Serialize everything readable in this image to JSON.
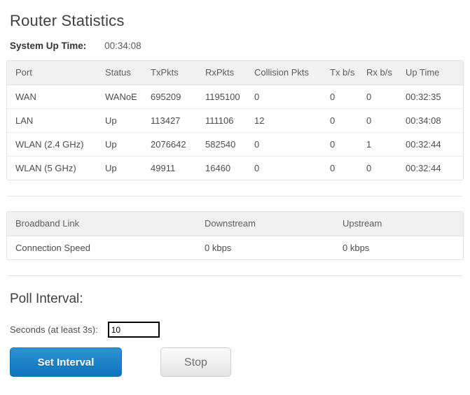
{
  "page": {
    "title": "Router Statistics"
  },
  "uptime": {
    "label": "System Up Time:",
    "value": "00:34:08"
  },
  "stats_table": {
    "headers": [
      "Port",
      "Status",
      "TxPkts",
      "RxPkts",
      "Collision Pkts",
      "Tx b/s",
      "Rx b/s",
      "Up Time"
    ],
    "rows": [
      {
        "port": "WAN",
        "status": "WANoE",
        "txpkts": "695209",
        "rxpkts": "1195100",
        "collision": "0",
        "txbs": "0",
        "rxbs": "0",
        "uptime": "00:32:35"
      },
      {
        "port": "LAN",
        "status": "Up",
        "txpkts": "113427",
        "rxpkts": "111106",
        "collision": "12",
        "txbs": "0",
        "rxbs": "0",
        "uptime": "00:34:08"
      },
      {
        "port": "WLAN (2.4 GHz)",
        "status": "Up",
        "txpkts": "2076642",
        "rxpkts": "582540",
        "collision": "0",
        "txbs": "0",
        "rxbs": "1",
        "uptime": "00:32:44"
      },
      {
        "port": "WLAN (5 GHz)",
        "status": "Up",
        "txpkts": "49911",
        "rxpkts": "16460",
        "collision": "0",
        "txbs": "0",
        "rxbs": "0",
        "uptime": "00:32:44"
      }
    ]
  },
  "broadband_table": {
    "headers": [
      "Broadband Link",
      "Downstream",
      "Upstream"
    ],
    "rows": [
      {
        "link": "Connection Speed",
        "downstream": "0 kbps",
        "upstream": "0 kbps"
      }
    ]
  },
  "poll": {
    "title": "Poll Interval:",
    "seconds_label": "Seconds (at least 3s):",
    "seconds_value": "10",
    "set_button_label": "Set Interval",
    "stop_button_label": "Stop"
  },
  "colors": {
    "primary_button": "#1f85c8",
    "header_bg": "#f1f1f1",
    "border": "#e2e2e2",
    "text": "#4d4d4d"
  }
}
